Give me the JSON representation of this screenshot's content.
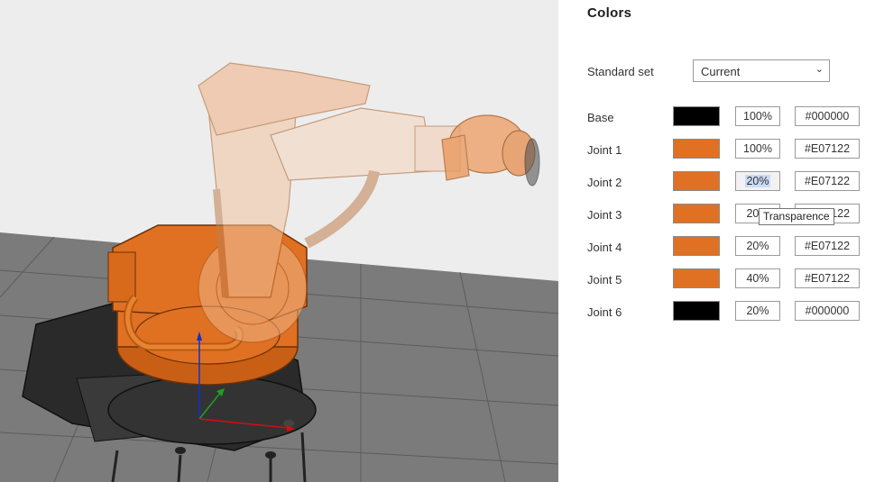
{
  "panel": {
    "title": "Colors",
    "standard_set": {
      "label": "Standard set",
      "value": "Current"
    }
  },
  "rows": [
    {
      "label": "Base",
      "color": "#000000",
      "transparency": "100%",
      "hex": "#000000"
    },
    {
      "label": "Joint 1",
      "color": "#E07122",
      "transparency": "100%",
      "hex": "#E07122"
    },
    {
      "label": "Joint 2",
      "color": "#E07122",
      "transparency": "20%",
      "hex": "#E07122"
    },
    {
      "label": "Joint 3",
      "color": "#E07122",
      "transparency": "20%",
      "hex": "#E07122"
    },
    {
      "label": "Joint 4",
      "color": "#E07122",
      "transparency": "20%",
      "hex": "#E07122"
    },
    {
      "label": "Joint 5",
      "color": "#E07122",
      "transparency": "40%",
      "hex": "#E07122"
    },
    {
      "label": "Joint 6",
      "color": "#000000",
      "transparency": "20%",
      "hex": "#000000"
    }
  ],
  "tooltip": {
    "text": "Transparence"
  },
  "scene": {
    "background_color": "#ededed",
    "floor_color": "#7a7a7a",
    "robot_color": "#E07122",
    "base_color": "#2a2a2a",
    "axis_colors": {
      "x": "#d01010",
      "y": "#1fa01f",
      "z": "#1030d0"
    }
  }
}
